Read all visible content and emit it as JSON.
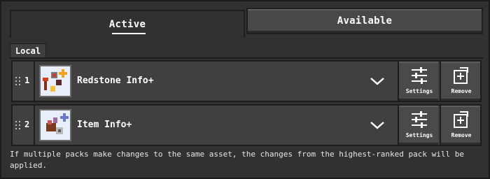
{
  "tabs": [
    {
      "label": "Active",
      "selected": true
    },
    {
      "label": "Available",
      "selected": false
    }
  ],
  "section": {
    "label": "Local"
  },
  "packs": [
    {
      "rank": "1",
      "name": "Redstone Info+",
      "icon": "redstone-info-pack-icon",
      "settings_label": "Settings",
      "remove_label": "Remove"
    },
    {
      "rank": "2",
      "name": "Item Info+",
      "icon": "item-info-pack-icon",
      "settings_label": "Settings",
      "remove_label": "Remove"
    }
  ],
  "footer": {
    "note": "If multiple packs make changes to the same asset, the changes from the highest-ranked pack will be applied."
  },
  "colors": {
    "background": "#313131",
    "row": "#404040",
    "button": "#4a4a4a",
    "border": "#1d1d1d",
    "text": "#ffffff"
  }
}
